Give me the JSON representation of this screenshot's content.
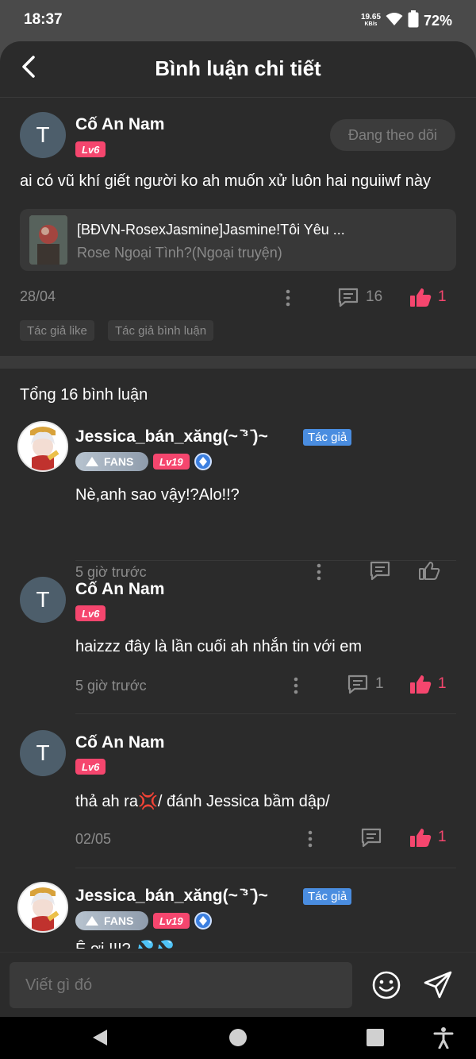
{
  "status_bar": {
    "time": "18:37",
    "net_speed_value": "19.65",
    "net_speed_unit": "KB/s",
    "battery": "72%"
  },
  "header": {
    "title": "Bình luận chi tiết"
  },
  "post": {
    "avatar_letter": "T",
    "username": "Cố An Nam",
    "level": "Lv6",
    "follow_label": "Đang theo dõi",
    "text": "ai có vũ khí giết người ko ah muốn xử luôn hai nguiiwf này",
    "novel_title": "[BĐVN-RosexJasmine]Jasmine!Tôi Yêu ...",
    "novel_subtitle": "Rose Ngoại Tình?(Ngoại truyện)",
    "date": "28/04",
    "comment_count": "16",
    "like_count": "1",
    "tags": [
      "Tác giả like",
      "Tác giả bình luận"
    ]
  },
  "total_comments": "Tổng 16 bình luận",
  "comments": [
    {
      "username": "Jessica_bán_xăng(~ ̄³ ̄)~",
      "author_tag": "Tác giả",
      "fans": "FANS",
      "level": "Lv19",
      "text": "Nè,anh sao vậy!?Alo!!?",
      "time": "5 giờ trước"
    },
    {
      "avatar_letter": "T",
      "username": "Cố An Nam",
      "level": "Lv6",
      "text": "haizzz đây là lần cuối ah nhắn tin với em",
      "time": "5 giờ trước",
      "reply_count": "1",
      "like_count": "1"
    },
    {
      "avatar_letter": "T",
      "username": "Cố An Nam",
      "level": "Lv6",
      "text": "thả ah ra💢/ đánh Jessica bầm dập/",
      "time": "02/05",
      "like_count": "1"
    },
    {
      "username": "Jessica_bán_xăng(~ ̄³ ̄)~",
      "author_tag": "Tác giả",
      "fans": "FANS",
      "level": "Lv19",
      "text": "Ê ơi !!!? 💦💦"
    }
  ],
  "input": {
    "placeholder": "Viết gì đó"
  },
  "colors": {
    "like_red": "#f5466e",
    "author_blue": "#4a8de0",
    "sheet_bg": "#2b2b2b"
  }
}
